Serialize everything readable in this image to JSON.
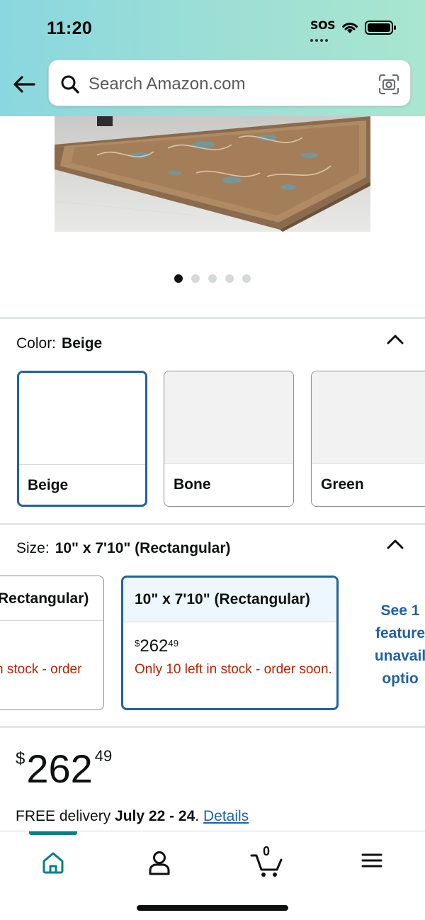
{
  "status_bar": {
    "time": "11:20",
    "sos": "SOS"
  },
  "search": {
    "placeholder": "Search Amazon.com"
  },
  "carousel": {
    "total": 5,
    "active_index": 0
  },
  "color": {
    "label": "Color:",
    "selected": "Beige",
    "options": [
      {
        "name": "Beige",
        "selected": true
      },
      {
        "name": "Bone",
        "selected": false
      },
      {
        "name": "Green",
        "selected": false
      }
    ]
  },
  "size": {
    "label": "Size:",
    "selected": "10\" x 7'10\" (Rectangular)",
    "options": [
      {
        "title": "Rectangular)",
        "stock": "n stock - order"
      },
      {
        "title": "10\" x 7'10\" (Rectangular)",
        "price_symbol": "$",
        "price_whole": "262",
        "price_fraction": "49",
        "stock": "Only 10 left in stock - order soon.",
        "selected": true
      }
    ],
    "see_more": [
      "See 1",
      "feature",
      "unavail",
      "optio"
    ]
  },
  "price": {
    "symbol": "$",
    "whole": "262",
    "fraction": "49"
  },
  "delivery": {
    "prefix": "FREE delivery",
    "dates": "July 22 - 24",
    "separator": ".",
    "link": "Details"
  },
  "bottom_nav": {
    "cart_count": "0",
    "active": "home"
  },
  "colors": {
    "accent": "#2162a1",
    "teal": "#00818a",
    "stock_red": "#b12704",
    "header_gradient_start": "#8ad7df",
    "header_gradient_end": "#a8e6cf"
  }
}
